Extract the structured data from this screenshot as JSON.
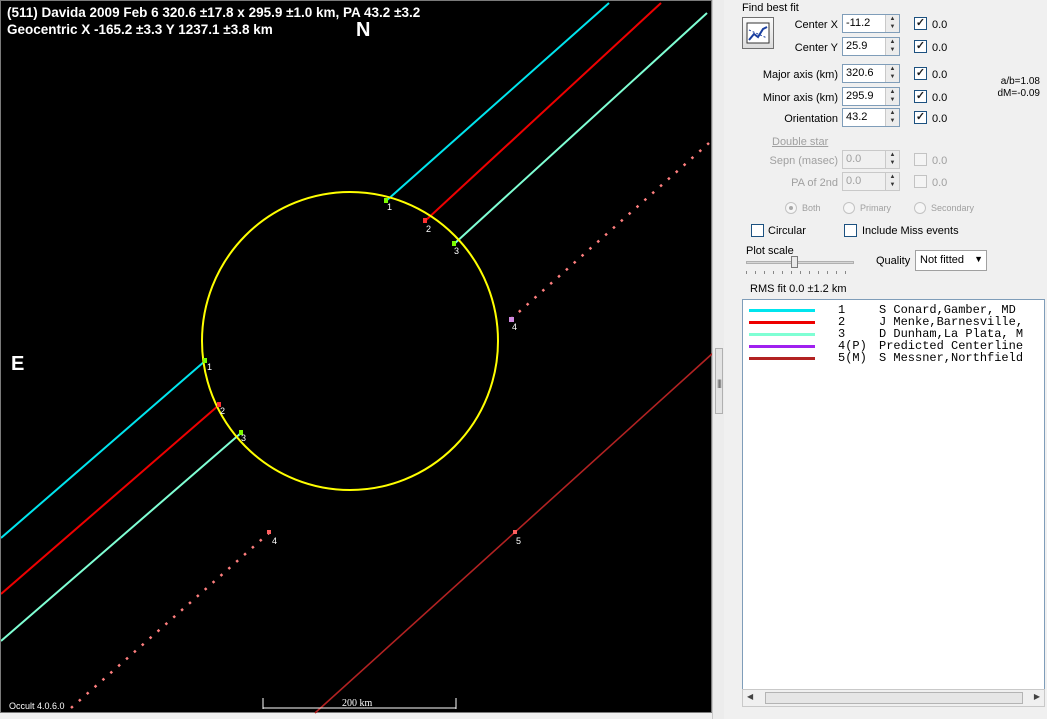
{
  "header": {
    "line1": "(511) Davida  2009 Feb 6   320.6 ±17.8 x 295.9 ±1.0 km, PA 43.2 ±3.2",
    "line2": "Geocentric  X  -165.2 ±3.3  Y 1237.1 ±3.8 km"
  },
  "compass": {
    "north": "N",
    "east": "E"
  },
  "plot": {
    "version_label": "Occult 4.0.6.0",
    "scale_label": "200 km",
    "ellipse_color": "#ffff00",
    "chord_labels": {
      "top": [
        "1",
        "2",
        "3"
      ],
      "bottom": [
        "1",
        "2",
        "3"
      ],
      "predicted_upper": "4",
      "predicted_lower": "4",
      "miss": "5"
    }
  },
  "panel": {
    "find_best_fit": "Find best fit",
    "fit_button_icon": "fit-chart-icon",
    "fields": {
      "center_x": {
        "label": "Center X",
        "value": "-11.2",
        "checked": true,
        "step": "0.0"
      },
      "center_y": {
        "label": "Center Y",
        "value": "25.9",
        "checked": true,
        "step": "0.0"
      },
      "major_axis": {
        "label": "Major axis (km)",
        "value": "320.6",
        "checked": true,
        "step": "0.0"
      },
      "minor_axis": {
        "label": "Minor axis (km)",
        "value": "295.9",
        "checked": true,
        "step": "0.0"
      },
      "orientation": {
        "label": "Orientation",
        "value": "43.2",
        "checked": true,
        "step": "0.0"
      }
    },
    "ratio": "a/b=1.08",
    "dm": "dM=-0.09",
    "double_star": {
      "title": "Double star",
      "sepn": {
        "label": "Sepn (masec)",
        "value": "0.0",
        "step": "0.0"
      },
      "pa2": {
        "label": "PA of 2nd",
        "value": "0.0",
        "step": "0.0"
      },
      "radios": [
        "Both",
        "Primary",
        "Secondary"
      ]
    },
    "circular_label": "Circular",
    "include_miss_label": "Include Miss events",
    "plot_scale_label": "Plot scale",
    "quality_label": "Quality",
    "quality_value": "Not fitted",
    "rms": "RMS fit  0.0 ±1.2 km"
  },
  "legend": [
    {
      "color": "#00e5ee",
      "num": "1",
      "name": "S Conard,Gamber, MD"
    },
    {
      "color": "#ee0000",
      "num": "2",
      "name": "J Menke,Barnesville,"
    },
    {
      "color": "#7fffd4",
      "num": "3",
      "name": "D Dunham,La Plata, M"
    },
    {
      "color": "#a020f0",
      "num": "4(P)",
      "name": "Predicted Centerline"
    },
    {
      "color": "#b22222",
      "num": "5(M)",
      "name": "S Messner,Northfield"
    }
  ]
}
